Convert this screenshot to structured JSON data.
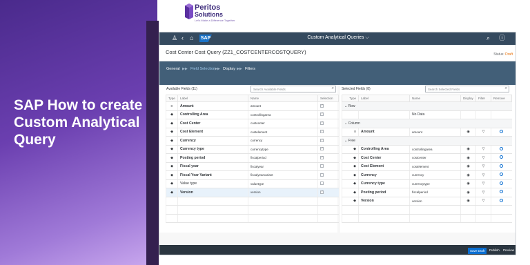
{
  "promo": {
    "title": "SAP How to create Custom Analytical Query"
  },
  "logo": {
    "name": "Peritos",
    "name2": "Solutions",
    "tagline": "Let's Make a Difference Together"
  },
  "shell": {
    "title": "Custom Analytical Queries",
    "title_caret": "⌵",
    "sap": "SAP"
  },
  "header": {
    "title": "Cost Center Cost Query (ZZ1_COSTCENTERCOSTQUERY)",
    "status_label": "Status:",
    "status_value": "Draft"
  },
  "nav": {
    "items": [
      {
        "label": "General"
      },
      {
        "label": "Field Selection"
      },
      {
        "label": "Display"
      },
      {
        "label": "Filters"
      }
    ]
  },
  "available": {
    "heading": "Available Fields (11)",
    "search_placeholder": "Search Available Fields",
    "columns": {
      "type": "Type",
      "label": "Label",
      "name": "Name",
      "selection": "Selection"
    },
    "rows": [
      {
        "icon": "≡",
        "label": "Amount",
        "name": "amount"
      },
      {
        "icon": "◆",
        "label": "Controlling Area",
        "name": "controllingarea"
      },
      {
        "icon": "◆",
        "label": "Cost Center",
        "name": "costcenter"
      },
      {
        "icon": "◆",
        "label": "Cost Element",
        "name": "costelement"
      },
      {
        "icon": "◆",
        "label": "Currency",
        "name": "currency"
      },
      {
        "icon": "◆",
        "label": "Currency type",
        "name": "currencytype"
      },
      {
        "icon": "◆",
        "label": "Posting period",
        "name": "fiscalperiod"
      },
      {
        "icon": "◆",
        "label": "Fiscal year",
        "name": "fiscalyear"
      },
      {
        "icon": "◆",
        "label": "Fiscal Year Variant",
        "name": "fiscalyearvariant"
      },
      {
        "icon": "◆",
        "label": "Value type",
        "name": "valuetype"
      },
      {
        "icon": "◆",
        "label": "Version",
        "name": "version"
      }
    ]
  },
  "selected": {
    "heading": "Selected Fields (8)",
    "search_placeholder": "Search Selected Fields",
    "columns": {
      "type": "Type",
      "label": "Label",
      "name": "Name",
      "display": "Display",
      "filter": "Filter",
      "remove": "Remove"
    },
    "groups": {
      "row": "Row",
      "column": "Column",
      "free": "Free"
    },
    "no_data": "No Data",
    "column_rows": [
      {
        "icon": "≡",
        "label": "Amount",
        "name": "amount"
      }
    ],
    "free_rows": [
      {
        "icon": "◆",
        "label": "Controlling Area",
        "name": "controllingarea"
      },
      {
        "icon": "◆",
        "label": "Cost Center",
        "name": "costcenter"
      },
      {
        "icon": "◆",
        "label": "Cost Element",
        "name": "costelement"
      },
      {
        "icon": "◆",
        "label": "Currency",
        "name": "currency"
      },
      {
        "icon": "◆",
        "label": "Currency type",
        "name": "currencytype"
      },
      {
        "icon": "◆",
        "label": "Posting period",
        "name": "fiscalperiod"
      },
      {
        "icon": "◆",
        "label": "Version",
        "name": "version"
      }
    ]
  },
  "footer": {
    "save_draft": "Save Draft",
    "publish": "Publish",
    "preview": "Preview"
  }
}
